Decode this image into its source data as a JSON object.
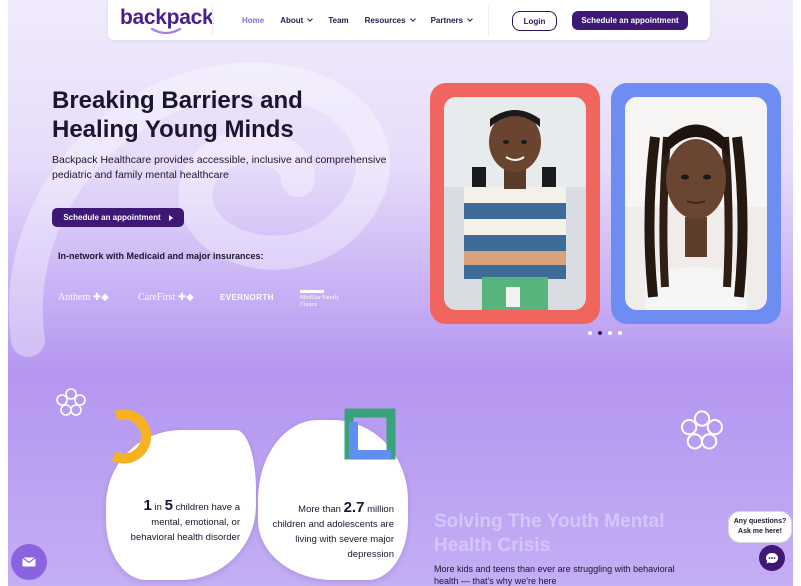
{
  "nav": {
    "logo": "backpack",
    "links": [
      {
        "label": "Home",
        "active": true,
        "dropdown": false
      },
      {
        "label": "About",
        "active": false,
        "dropdown": true
      },
      {
        "label": "Team",
        "active": false,
        "dropdown": false
      },
      {
        "label": "Resources",
        "active": false,
        "dropdown": true
      },
      {
        "label": "Partners",
        "active": false,
        "dropdown": true
      }
    ],
    "login_label": "Login",
    "schedule_label": "Schedule an appointment"
  },
  "hero": {
    "title_line1": "Breaking Barriers and",
    "title_line2": "Healing Young Minds",
    "description": "Backpack Healthcare provides accessible, inclusive and comprehensive pediatric and family mental healthcare",
    "cta_label": "Schedule an appointment",
    "insurance_label": "In-network with Medicaid and major insurances:",
    "insurers": [
      "Anthem",
      "CareFirst",
      "EVERNORTH",
      "MedStar Family Choice"
    ],
    "carousel": {
      "total": 4,
      "active": 1
    }
  },
  "stats": [
    {
      "pre": "",
      "num1": "1",
      "mid": " in ",
      "num2": "5",
      "post": " children have a mental, emotional, or behavioral health disorder"
    },
    {
      "pre": "More than ",
      "num1": "2.7",
      "post": " million children and adolescents are living with severe major depression"
    }
  ],
  "solving": {
    "title": "Solving The Youth Mental Health Crisis",
    "description": "More kids and teens than ever are struggling with behavioral health — that's why we're here"
  },
  "chat": {
    "bubble_line1": "Any questions?",
    "bubble_line2": "Ask me here!"
  },
  "icons": {
    "mail": "mail-icon",
    "chat": "chat-icon",
    "dropdown": "chevron-down-icon",
    "flower": "flower-outline-icon"
  },
  "colors": {
    "brand_purple": "#3d1875",
    "logo_purple": "#4a1f8c",
    "card_red": "#f0655e",
    "card_blue": "#6d8df2",
    "accent_yellow": "#f6b21f",
    "accent_green": "#3aa27a",
    "accent_blue": "#5f8ff0",
    "lavender": "#b596f1"
  }
}
